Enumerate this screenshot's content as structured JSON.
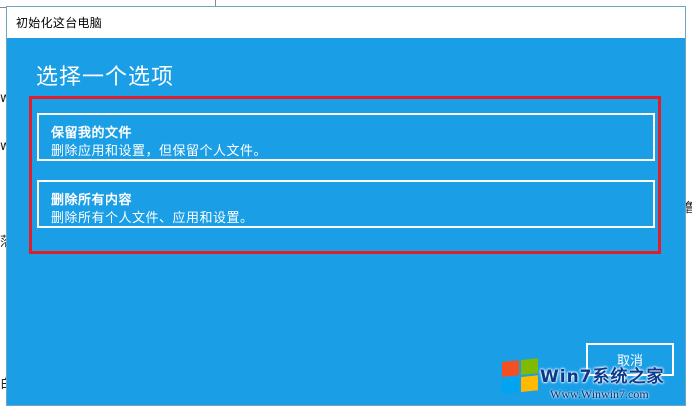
{
  "background": {
    "fragments": [
      "w",
      "w",
      "落",
      "鲁",
      "白"
    ]
  },
  "dialog": {
    "title": "初始化这台电脑",
    "heading": "选择一个选项",
    "options": [
      {
        "title": "保留我的文件",
        "description": "删除应用和设置，但保留个人文件。"
      },
      {
        "title": "删除所有内容",
        "description": "删除所有个人文件、应用和设置。"
      }
    ],
    "cancel_label": "取消"
  },
  "watermark": {
    "text": "Win7系统之家",
    "url": "Www.Winwin7.com"
  },
  "colors": {
    "dialog_bg": "#1a9ee6",
    "highlight": "#e11d2b"
  }
}
